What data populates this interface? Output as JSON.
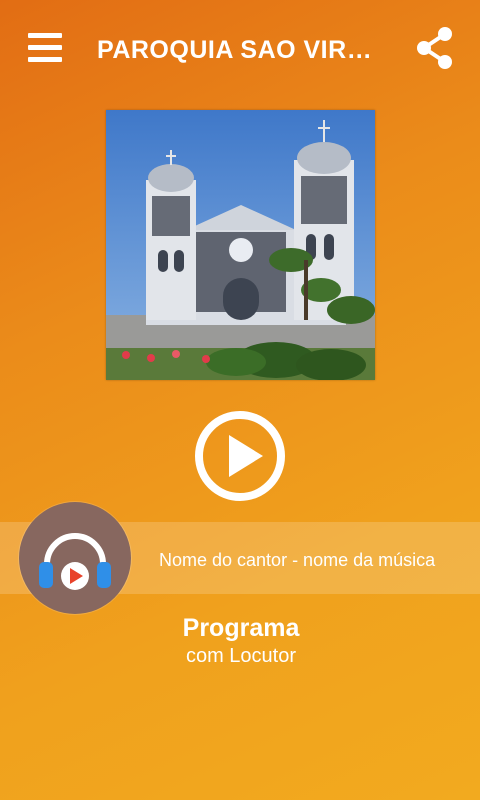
{
  "header": {
    "title": "PAROQUIA SAO VIRG...",
    "menu_icon": "hamburger-menu-icon",
    "share_icon": "share-icon"
  },
  "cover": {
    "image": "church-photo"
  },
  "player": {
    "play_icon": "play-icon",
    "now_playing": "Nome do cantor - nome da música",
    "program": "Programa",
    "host": "com Locutor"
  },
  "colors": {
    "background_top": "#e26d14",
    "background_bottom": "#f2aa1f",
    "avatar_bg": "#87675f",
    "headphone_blue": "#2f8fe8",
    "play_red": "#e8432b"
  }
}
